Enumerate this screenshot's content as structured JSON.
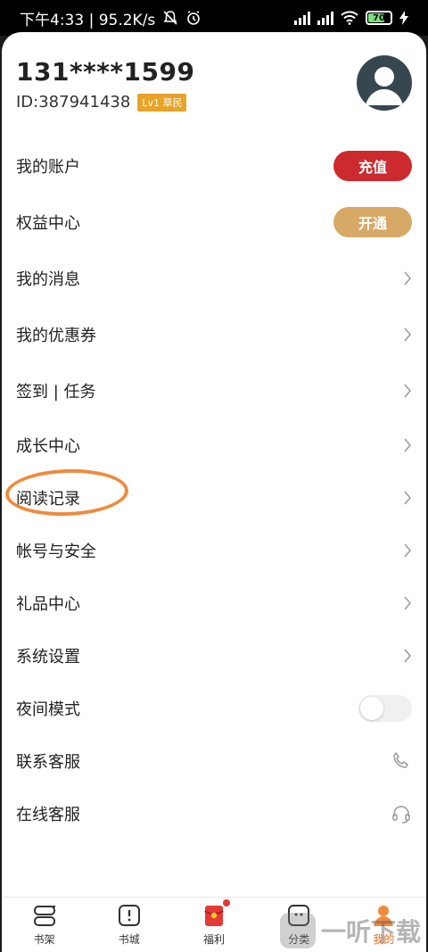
{
  "status_bar": {
    "time_speed": "下午4:33 | 95.2K/s",
    "battery_level": "70"
  },
  "profile": {
    "phone": "131****1599",
    "id": "ID:387941438",
    "level_badge": "Lv1 草民"
  },
  "menu": {
    "account": {
      "label": "我的账户",
      "action": "充值"
    },
    "benefits": {
      "label": "权益中心",
      "action": "开通"
    },
    "messages": "我的消息",
    "coupons": "我的优惠券",
    "checkin": "签到 | 任务",
    "growth": "成长中心",
    "reading_history": "阅读记录",
    "account_security": "帐号与安全",
    "gift_center": "礼品中心",
    "settings": "系统设置",
    "night_mode": "夜间模式",
    "contact_service": "联系客服",
    "online_service": "在线客服"
  },
  "bottom_nav": {
    "items": [
      {
        "label": "书架",
        "icon": "bookshelf-icon"
      },
      {
        "label": "书城",
        "icon": "bookstore-icon"
      },
      {
        "label": "福利",
        "icon": "red-envelope-icon"
      },
      {
        "label": "分类",
        "icon": "category-icon"
      },
      {
        "label": "我的",
        "icon": "profile-icon"
      }
    ]
  },
  "watermark": "一听下载",
  "colors": {
    "recharge": "#cc2a2f",
    "open": "#d7a966",
    "active_tab": "#e46a17",
    "level_badge": "#e8a329",
    "annotation": "#f08a3c"
  },
  "night_mode_on": false
}
